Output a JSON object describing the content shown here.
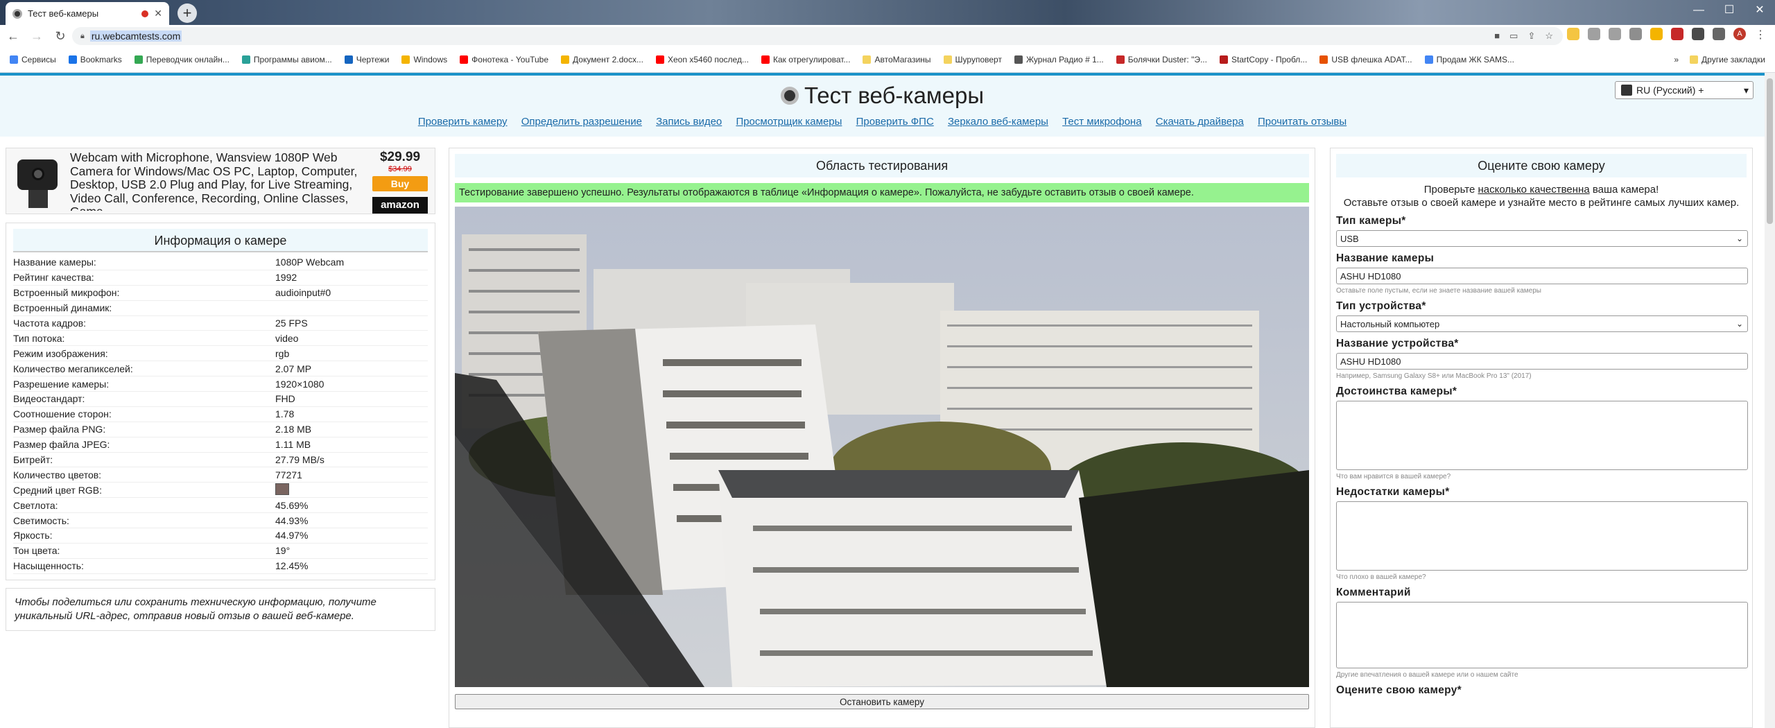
{
  "browser": {
    "tab_title": "Тест веб-камеры",
    "url": "ru.webcamtests.com",
    "bookmarks": [
      {
        "label": "Сервисы",
        "color": "#4285f4"
      },
      {
        "label": "Bookmarks",
        "color": "#1a73e8"
      },
      {
        "label": "Переводчик онлайн...",
        "color": "#34a853"
      },
      {
        "label": "Программы авиом...",
        "color": "#2aa198"
      },
      {
        "label": "Чертежи",
        "color": "#1565c0"
      },
      {
        "label": "Windows",
        "color": "#f4b400"
      },
      {
        "label": "Фонотека - YouTube",
        "color": "#ff0000"
      },
      {
        "label": "Документ 2.docx...",
        "color": "#f4b400"
      },
      {
        "label": "Xeon x5460 послед...",
        "color": "#ff0000"
      },
      {
        "label": "Как отрегулироват...",
        "color": "#ff0000"
      },
      {
        "label": "АвтоМагазины",
        "color": "#f4d35e"
      },
      {
        "label": "Шуруповерт",
        "color": "#f4d35e"
      },
      {
        "label": "Журнал Радио # 1...",
        "color": "#555555"
      },
      {
        "label": "Болячки Duster: \"Э...",
        "color": "#c62828"
      },
      {
        "label": "StartCopy - Пробл...",
        "color": "#b71c1c"
      },
      {
        "label": "USB флешка ADAT...",
        "color": "#e65100"
      },
      {
        "label": "Продам ЖК SAMS...",
        "color": "#4285f4"
      }
    ],
    "bookmarks_more": "»",
    "other_bookmarks": "Другие закладки",
    "profile_letter": "A"
  },
  "header": {
    "title": "Тест веб-камеры",
    "nav": [
      "Проверить камеру",
      "Определить разрешение",
      "Запись видео",
      "Просмотрщик камеры",
      "Проверить ФПС",
      "Зеркало веб-камеры",
      "Тест микрофона",
      "Скачать драйвера",
      "Прочитать отзывы"
    ],
    "language": "RU (Русский) +"
  },
  "ad": {
    "text": "Webcam with Microphone, Wansview 1080P Web Camera for Windows/Mac OS PC, Laptop, Computer, Desktop, USB 2.0 Plug and Play, for Live Streaming, Video Call, Conference, Recording, Online Classes, Game",
    "price": "$29.99",
    "old_price": "$34.99",
    "buy": "Buy",
    "store": "amazon"
  },
  "info": {
    "title": "Информация о камере",
    "rows": [
      {
        "k": "Название камеры:",
        "v": "1080P Webcam"
      },
      {
        "k": "Рейтинг качества:",
        "v": "1992"
      },
      {
        "k": "Встроенный микрофон:",
        "v": "audioinput#0"
      },
      {
        "k": "Встроенный динамик:",
        "v": ""
      },
      {
        "k": "Частота кадров:",
        "v": "25 FPS"
      },
      {
        "k": "Тип потока:",
        "v": "video"
      },
      {
        "k": "Режим изображения:",
        "v": "rgb"
      },
      {
        "k": "Количество мегапикселей:",
        "v": "2.07 MP"
      },
      {
        "k": "Разрешение камеры:",
        "v": "1920×1080"
      },
      {
        "k": "Видеостандарт:",
        "v": "FHD"
      },
      {
        "k": "Соотношение сторон:",
        "v": "1.78"
      },
      {
        "k": "Размер файла PNG:",
        "v": "2.18 MB"
      },
      {
        "k": "Размер файла JPEG:",
        "v": "1.11 MB"
      },
      {
        "k": "Битрейт:",
        "v": "27.79 MB/s"
      },
      {
        "k": "Количество цветов:",
        "v": "77271"
      },
      {
        "k": "Средний цвет RGB:",
        "v": ""
      },
      {
        "k": "Светлота:",
        "v": "45.69%"
      },
      {
        "k": "Светимость:",
        "v": "44.93%"
      },
      {
        "k": "Яркость:",
        "v": "44.97%"
      },
      {
        "k": "Тон цвета:",
        "v": "19°"
      },
      {
        "k": "Насыщенность:",
        "v": "12.45%"
      }
    ],
    "avg_color": "#7a6560",
    "share_text": "Чтобы поделиться или сохранить техническую информацию, получите уникальный URL-адрес, отправив новый отзыв о вашей веб-камере."
  },
  "test": {
    "title": "Область тестирования",
    "success": "Тестирование завершено успешно. Результаты отображаются в таблице «Информация о камере». Пожалуйста, не забудьте оставить отзыв о своей камере.",
    "stop_button": "Остановить камеру"
  },
  "review": {
    "title": "Оцените свою камеру",
    "intro_before": "Проверьте",
    "intro_link": "насколько качественна",
    "intro_after": "ваша камера!",
    "intro_line2": "Оставьте отзыв о своей камере и узнайте место в рейтинге самых лучших камер.",
    "camera_type_label": "Тип камеры*",
    "camera_type_value": "USB",
    "camera_name_label": "Название камеры",
    "camera_name_value": "ASHU HD1080",
    "camera_name_hint": "Оставьте поле пустым, если не знаете название вашей камеры",
    "device_type_label": "Тип устройства*",
    "device_type_value": "Настольный компьютер",
    "device_name_label": "Название устройства*",
    "device_name_value": "ASHU HD1080",
    "device_name_hint": "Например, Samsung Galaxy S8+ или MacBook Pro 13\" (2017)",
    "pros_label": "Достоинства камеры*",
    "pros_hint": "Что вам нравится в вашей камере?",
    "cons_label": "Недостатки камеры*",
    "cons_hint": "Что плохо в вашей камере?",
    "comment_label": "Комментарий",
    "comment_hint": "Другие впечатления о вашей камере или о нашем сайте",
    "rate_label": "Оцените свою камеру*"
  }
}
